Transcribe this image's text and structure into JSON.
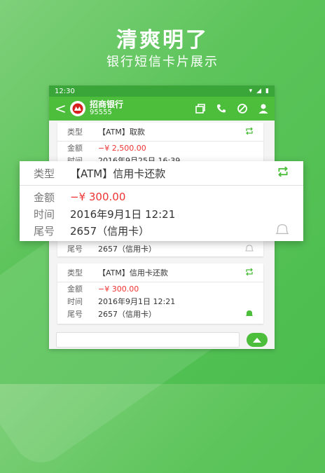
{
  "headline": "清爽明了",
  "subline": "银行短信卡片展示",
  "status": {
    "time": "12:30"
  },
  "header": {
    "back": "<",
    "bank_name": "招商银行",
    "bank_number": "95555"
  },
  "card1": {
    "type_label": "类型",
    "type_value": "【ATM】取款",
    "amount_label": "金额",
    "amount_value": "−¥ 2,500.00",
    "time_label": "时间",
    "time_value": "2016年9月25日 16:39"
  },
  "card2": {
    "tail_label": "尾号",
    "tail_value": "2657（信用卡）"
  },
  "card3": {
    "type_label": "类型",
    "type_value": "【ATM】信用卡还款",
    "amount_label": "金额",
    "amount_value": "−¥ 300.00",
    "time_label": "时间",
    "time_value": "2016年9月1日 12:21",
    "tail_label": "尾号",
    "tail_value": "2657（信用卡）"
  },
  "popup": {
    "type_label": "类型",
    "type_value": "【ATM】信用卡还款",
    "amount_label": "金额",
    "amount_value": "−¥ 300.00",
    "time_label": "时间",
    "time_value": "2016年9月1日 12:21",
    "tail_label": "尾号",
    "tail_value": "2657（信用卡）"
  },
  "colors": {
    "accent": "#4dbe3c",
    "amount": "#e33333"
  }
}
